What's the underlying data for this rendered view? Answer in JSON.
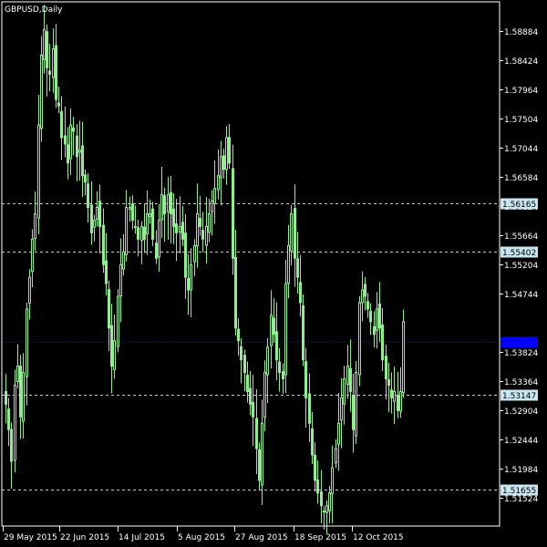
{
  "window": {
    "title": "GBPUSD,Daily",
    "symbol": "GBPUSD",
    "timeframe": "Daily"
  },
  "colors": {
    "background": "#000000",
    "axis": "#ffffff",
    "candle": "#90ee90",
    "hline": "#c8c8c8",
    "current_line": "#0000ff",
    "tag_fill": "#c8e6f0",
    "current_tag_fill": "#0000ff"
  },
  "chart_data": {
    "type": "candlestick",
    "title": "GBPUSD,Daily",
    "ylim": [
      1.5108,
      1.5934
    ],
    "y_ticks": [
      "1.58884",
      "1.58424",
      "1.57964",
      "1.57504",
      "1.57044",
      "1.56584",
      "1.56124",
      "1.55664",
      "1.55204",
      "1.54744",
      "1.53824",
      "1.53364",
      "1.52904",
      "1.52444",
      "1.51984",
      "1.51524"
    ],
    "x_ticks": [
      "29 May 2015",
      "22 Jun 2015",
      "14 Jul 2015",
      "5 Aug 2015",
      "27 Aug 2015",
      "18 Sep 2015",
      "12 Oct 2015"
    ],
    "grid": false,
    "horizontal_levels": [
      {
        "value": 1.56165,
        "label": "1.56165",
        "style": "dashed"
      },
      {
        "value": 1.55402,
        "label": "1.55402",
        "style": "dashed"
      },
      {
        "value": 1.53147,
        "label": "1.53147",
        "style": "dashed"
      },
      {
        "value": 1.51655,
        "label": "1.51655",
        "style": "dashed"
      }
    ],
    "current_price": {
      "value": 1.53975,
      "style": "dotted"
    },
    "closes": [
      1.53,
      1.526,
      1.521,
      1.533,
      1.536,
      1.528,
      1.535,
      1.545,
      1.55,
      1.556,
      1.56,
      1.574,
      1.585,
      1.589,
      1.583,
      1.582,
      1.586,
      1.578,
      1.577,
      1.572,
      1.571,
      1.568,
      1.574,
      1.573,
      1.569,
      1.57,
      1.566,
      1.565,
      1.561,
      1.557,
      1.559,
      1.561,
      1.558,
      1.552,
      1.549,
      1.542,
      1.536,
      1.54,
      1.547,
      1.552,
      1.554,
      1.561,
      1.561,
      1.559,
      1.558,
      1.556,
      1.558,
      1.556,
      1.56,
      1.56,
      1.556,
      1.553,
      1.559,
      1.563,
      1.56,
      1.563,
      1.56,
      1.558,
      1.557,
      1.558,
      1.556,
      1.55,
      1.548,
      1.552,
      1.555,
      1.56,
      1.558,
      1.556,
      1.558,
      1.56,
      1.562,
      1.564,
      1.566,
      1.569,
      1.567,
      1.572,
      1.568,
      1.553,
      1.542,
      1.54,
      1.537,
      1.535,
      1.532,
      1.53,
      1.528,
      1.523,
      1.518,
      1.527,
      1.535,
      1.539,
      1.544,
      1.541,
      1.537,
      1.535,
      1.534,
      1.549,
      1.555,
      1.56,
      1.553,
      1.55,
      1.546,
      1.537,
      1.531,
      1.527,
      1.522,
      1.518,
      1.516,
      1.514,
      1.513,
      1.514,
      1.516,
      1.52,
      1.523,
      1.527,
      1.531,
      1.534,
      1.536,
      1.532,
      1.526,
      1.535,
      1.546,
      1.548,
      1.547,
      1.545,
      1.543,
      1.541,
      1.545,
      1.542,
      1.537,
      1.534,
      1.533,
      1.531,
      1.532,
      1.529,
      1.532,
      1.543
    ]
  }
}
